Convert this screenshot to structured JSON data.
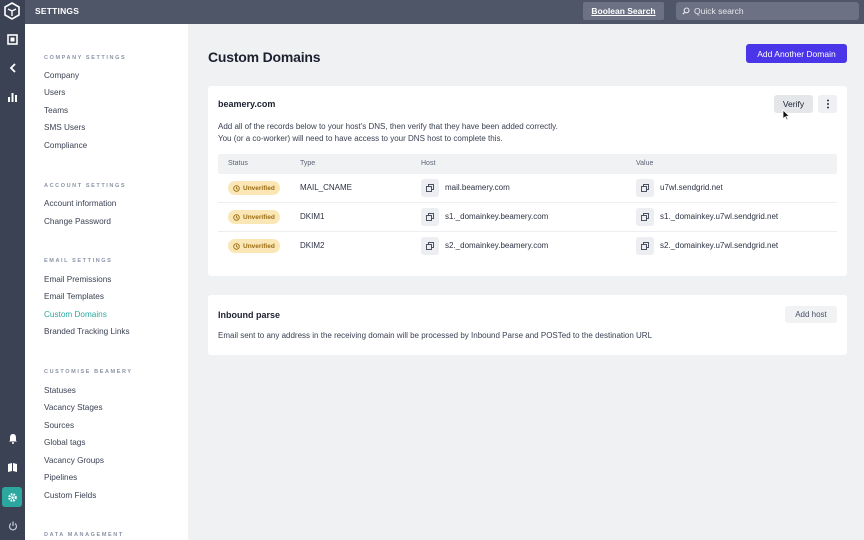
{
  "topbar": {
    "title": "SETTINGS",
    "boolean_search_label": "Boolean Search",
    "search_placeholder": "Quick search"
  },
  "sidebar": {
    "sections": [
      {
        "title": "COMPANY SETTINGS",
        "items": [
          "Company",
          "Users",
          "Teams",
          "SMS Users",
          "Compliance"
        ]
      },
      {
        "title": "ACCOUNT SETTINGS",
        "items": [
          "Account information",
          "Change Password"
        ]
      },
      {
        "title": "EMAIL SETTINGS",
        "items": [
          "Email Premissions",
          "Email Templates",
          "Custom Domains",
          "Branded Tracking Links"
        ]
      },
      {
        "title": "CUSTOMISE BEAMERY",
        "items": [
          "Statuses",
          "Vacancy Stages",
          "Sources",
          "Global tags",
          "Vacancy Groups",
          "Pipelines",
          "Custom Fields"
        ]
      },
      {
        "title": "DATA MANAGEMENT",
        "items": []
      }
    ],
    "active_item": "Custom Domains"
  },
  "main": {
    "title": "Custom Domains",
    "add_domain_label": "Add Another Domain",
    "domain_card": {
      "domain": "beamery.com",
      "verify_label": "Verify",
      "description_line1": "Add all of the records below to your host's DNS, then verify that they have been added correctly.",
      "description_line2": "You (or a co-worker) will need to have access to your DNS host to complete this.",
      "columns": [
        "Status",
        "Type",
        "Host",
        "Value"
      ],
      "rows": [
        {
          "status": "Unverified",
          "type": "MAIL_CNAME",
          "host": "mail.beamery.com",
          "value": "u7wl.sendgrid.net"
        },
        {
          "status": "Unverified",
          "type": "DKIM1",
          "host": "s1._domainkey.beamery.com",
          "value": "s1._domainkey.u7wl.sendgrid.net"
        },
        {
          "status": "Unverified",
          "type": "DKIM2",
          "host": "s2._domainkey.beamery.com",
          "value": "s2._domainkey.u7wl.sendgrid.net"
        }
      ]
    },
    "inbound_card": {
      "title": "Inbound parse",
      "add_host_label": "Add host",
      "description": "Email sent to any address in the receiving domain will be processed by Inbound Parse and POSTed to the destination URL"
    }
  },
  "colors": {
    "accent": "#4a35e8",
    "active_teal": "#2aa8a0",
    "badge_bg": "#fbe7b5",
    "topbar": "#4f5668",
    "rail": "#3b4254"
  },
  "icons": [
    "beamery-logo-icon",
    "dashboard-icon",
    "collapse-chevron-icon",
    "bar-chart-icon",
    "bell-icon",
    "book-icon",
    "gear-icon",
    "power-icon",
    "search-icon",
    "more-vertical-icon",
    "copy-icon",
    "clock-icon",
    "pointer-cursor-icon"
  ]
}
